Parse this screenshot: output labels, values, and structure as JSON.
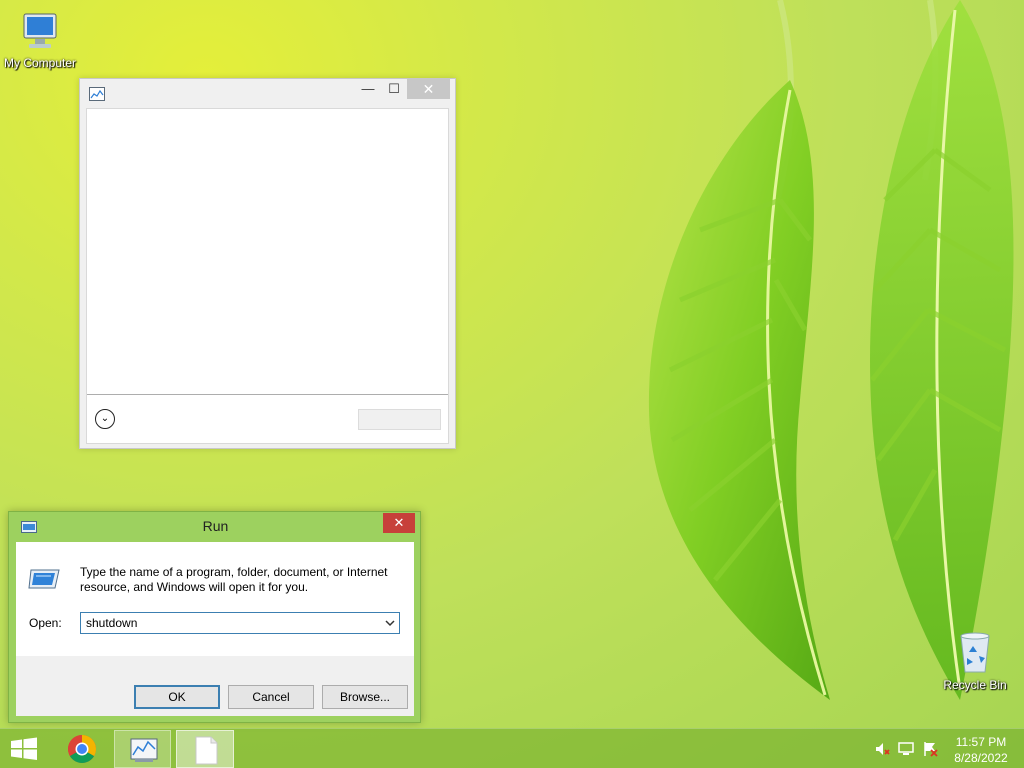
{
  "desktop": {
    "icons": [
      {
        "label": "My Computer",
        "icon": "computer-icon"
      },
      {
        "label": "Recycle Bin",
        "icon": "recycle-bin-icon"
      }
    ]
  },
  "blank_window": {
    "title": "",
    "caption_buttons": {
      "minimize": "—",
      "maximize": "☐",
      "close": "✕"
    },
    "expand_glyph": "⌄"
  },
  "run_dialog": {
    "title": "Run",
    "close_glyph": "✕",
    "description": "Type the name of a program, folder, document, or Internet resource, and Windows will open it for you.",
    "open_label": "Open:",
    "open_value": "shutdown",
    "buttons": {
      "ok": "OK",
      "cancel": "Cancel",
      "browse": "Browse..."
    }
  },
  "taskbar": {
    "items": [
      "start-icon",
      "chrome-icon",
      "performance-monitor-icon",
      "document-icon"
    ],
    "tray": [
      "speaker-muted-icon",
      "network-icon",
      "action-center-flag-icon"
    ],
    "clock": {
      "time": "11:57 PM",
      "date": "8/28/2022"
    }
  },
  "colors": {
    "run_frame": "#9dd15f",
    "close_red": "#c7403a",
    "focus_blue": "#3c7fb1",
    "taskbar": "#6eaa28"
  }
}
